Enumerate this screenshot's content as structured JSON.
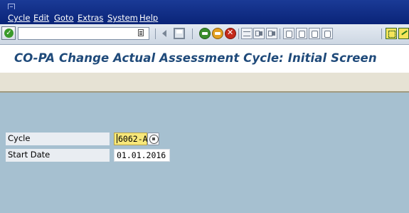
{
  "menubar": {
    "items": [
      "Cycle",
      "Edit",
      "Goto",
      "Extras",
      "System",
      "Help"
    ]
  },
  "toolbar": {
    "command_value": "",
    "icons": {
      "enter": "checkmark-icon",
      "command_history": "dropdown-icon",
      "back_nav": "nav-left-icon",
      "save": "save-icon",
      "back": "back-icon",
      "exit": "exit-icon",
      "cancel": "cancel-icon",
      "print": "print-icon",
      "find": "find-icon",
      "find_next": "find-next-icon",
      "first_page": "first-page-icon",
      "previous_page": "previous-page-icon",
      "next_page": "next-page-icon",
      "last_page": "last-page-icon",
      "layout": "layout-icon",
      "generate": "generate-icon"
    }
  },
  "title": "CO-PA Change Actual Assessment Cycle: Initial Screen",
  "form": {
    "cycle_label": "Cycle",
    "cycle_value": "6062-A",
    "start_date_label": "Start Date",
    "start_date_value": "01.01.2016"
  },
  "colors": {
    "menubar": "#0a2478",
    "title_text": "#1f4a7a",
    "app_toolbar": "#e6e2d4",
    "body_background": "#a6c0d0",
    "focused_input": "#f7e77a"
  }
}
